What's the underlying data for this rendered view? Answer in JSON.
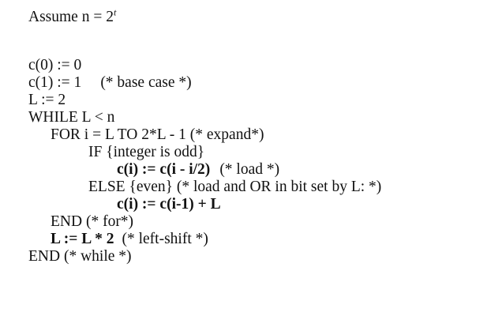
{
  "assumption": {
    "text": "Assume n = 2",
    "exponent": "t"
  },
  "code": {
    "c0": "c(0) := 0",
    "c1": "c(1) := 1",
    "c1_comment": "(* base case *)",
    "l_init": "L := 2",
    "while": "WHILE L < n",
    "for": "FOR i = L TO 2*L - 1",
    "for_comment": "(* expand*)",
    "if": "IF {integer is odd}",
    "load": "c(i) := c(i - i/2)",
    "load_comment": "(* load *)",
    "else": "ELSE {even}",
    "else_comment": "(* load and OR in bit set by L: *)",
    "or_line": "c(i) := c(i-1) + L",
    "end_for": "END (* for*)",
    "shift": "L := L * 2",
    "shift_comment": "(* left-shift *)",
    "end_while": "END (* while *)"
  }
}
